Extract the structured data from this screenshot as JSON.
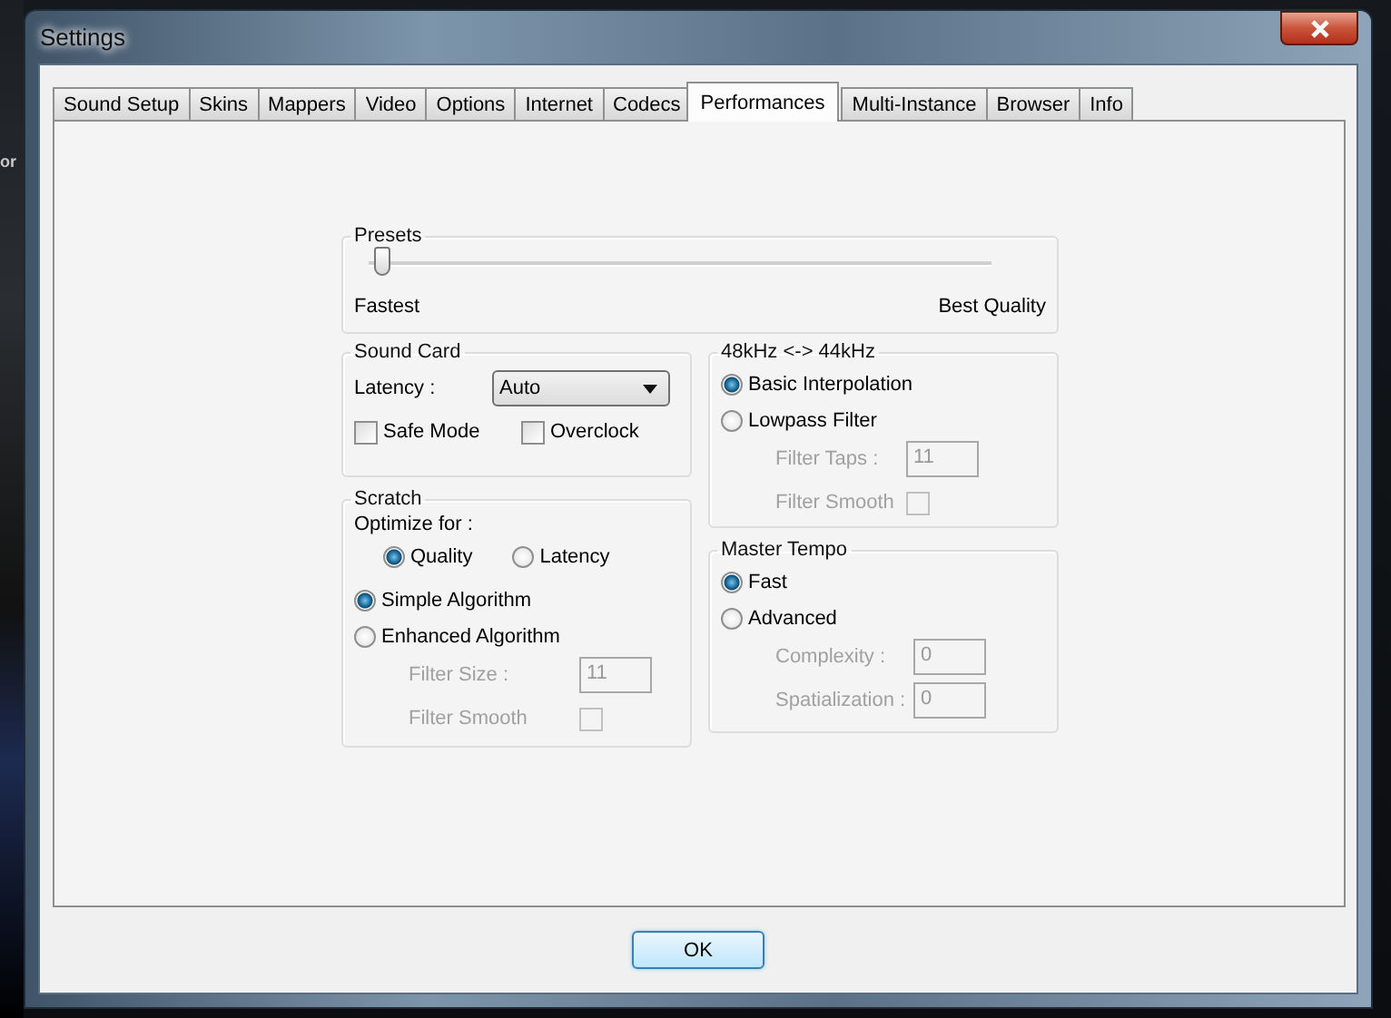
{
  "background": {
    "text": "or"
  },
  "window": {
    "title": "Settings"
  },
  "tabs": [
    {
      "label": "Sound Setup",
      "selected": false
    },
    {
      "label": "Skins",
      "selected": false
    },
    {
      "label": "Mappers",
      "selected": false
    },
    {
      "label": "Video",
      "selected": false
    },
    {
      "label": "Options",
      "selected": false
    },
    {
      "label": "Internet",
      "selected": false
    },
    {
      "label": "Codecs",
      "selected": false
    },
    {
      "label": "Performances",
      "selected": true
    },
    {
      "label": "Multi-Instance",
      "selected": false
    },
    {
      "label": "Browser",
      "selected": false
    },
    {
      "label": "Info",
      "selected": false
    }
  ],
  "presets": {
    "title": "Presets",
    "level": 0.02,
    "min_label": "Fastest",
    "max_label": "Best Quality"
  },
  "sound_card": {
    "title": "Sound Card",
    "latency_label": "Latency :",
    "latency_value": "Auto",
    "checkboxes": [
      {
        "label": "Safe Mode",
        "checked": false
      },
      {
        "label": "Overclock",
        "checked": false
      }
    ]
  },
  "scratch": {
    "title": "Scratch",
    "optimize_label": "Optimize for :",
    "optimize_options": [
      {
        "label": "Quality",
        "selected": true
      },
      {
        "label": "Latency",
        "selected": false
      }
    ],
    "algorithms": [
      {
        "label": "Simple Algorithm",
        "selected": true
      },
      {
        "label": "Enhanced Algorithm",
        "selected": false
      }
    ],
    "fields": [
      {
        "kind": "text",
        "label": "Filter Size :",
        "value": "11",
        "disabled": true
      },
      {
        "kind": "checkbox",
        "label": "Filter Smooth",
        "checked": false,
        "disabled": true
      }
    ]
  },
  "resampling": {
    "title": "48kHz <-> 44kHz",
    "options": [
      {
        "label": "Basic Interpolation",
        "selected": true
      },
      {
        "label": "Lowpass Filter",
        "selected": false
      }
    ],
    "fields": [
      {
        "kind": "text",
        "label": "Filter Taps :",
        "value": "11",
        "disabled": true
      },
      {
        "kind": "checkbox",
        "label": "Filter Smooth",
        "checked": false,
        "disabled": true
      }
    ]
  },
  "master_tempo": {
    "title": "Master Tempo",
    "options": [
      {
        "label": "Fast",
        "selected": true
      },
      {
        "label": "Advanced",
        "selected": false
      }
    ],
    "fields": [
      {
        "kind": "text",
        "label": "Complexity :",
        "value": "0",
        "disabled": true
      },
      {
        "kind": "text",
        "label": "Spatialization :",
        "value": "0",
        "disabled": true
      }
    ]
  },
  "ok_button": "OK"
}
